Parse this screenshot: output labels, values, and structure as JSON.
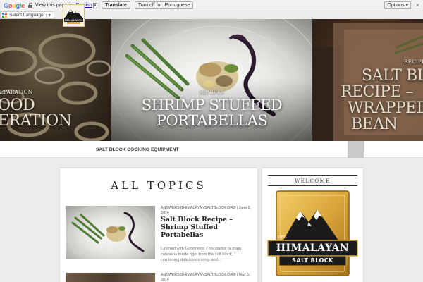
{
  "translate_bar": {
    "logo_text": "Google",
    "prefix": "View this page in:",
    "language": "English",
    "translate_label": "Translate",
    "turn_off_label": "Turn off for: Portuguese",
    "options_label": "Options ▾",
    "close_label": "×"
  },
  "select_language": {
    "label": "Select Language",
    "arrow": "▼"
  },
  "hero": {
    "left": {
      "category": "REPARATION",
      "title_line1": "OOD",
      "title_line2": "ERATION"
    },
    "center": {
      "category": "RECIPES",
      "title_line1": "SHRIMP STUFFED",
      "title_line2": "PORTABELLAS"
    },
    "right": {
      "category": "RECIPES",
      "title_line1": "SALT BL",
      "title_line2": "RECIPE –",
      "title_line3": "WRAPPED",
      "title_line4": "BEAN"
    }
  },
  "nav": {
    "link_1": "SALT BLOCK COOKING EQUIPMENT"
  },
  "main": {
    "section_title": "ALL TOPICS",
    "posts": [
      {
        "meta": "ANSWERS@HIMALAYANSALTBLOCK.ORG | June 9, 2014",
        "title": "Salt Block Recipe – Shrimp Stuffed Portabellas",
        "excerpt": "Layered with Goodness! This starter or main course is made right from the salt block, combining delicious shrimp and..."
      },
      {
        "meta": "ANSWERS@HIMALAYANSALTBLOCK.ORG | May 5, 2014",
        "title": "",
        "excerpt": ""
      }
    ]
  },
  "sidebar": {
    "title": "WELCOME",
    "logo": {
      "top_text": ".ORG",
      "name": "HIMALAYAN",
      "sub": "SALT BLOCK"
    }
  },
  "colors": {
    "gold": "#d9a43a",
    "gold_dark": "#a8741c",
    "brand_black": "#1b1b1b",
    "link_blue": "#1a0dab"
  }
}
